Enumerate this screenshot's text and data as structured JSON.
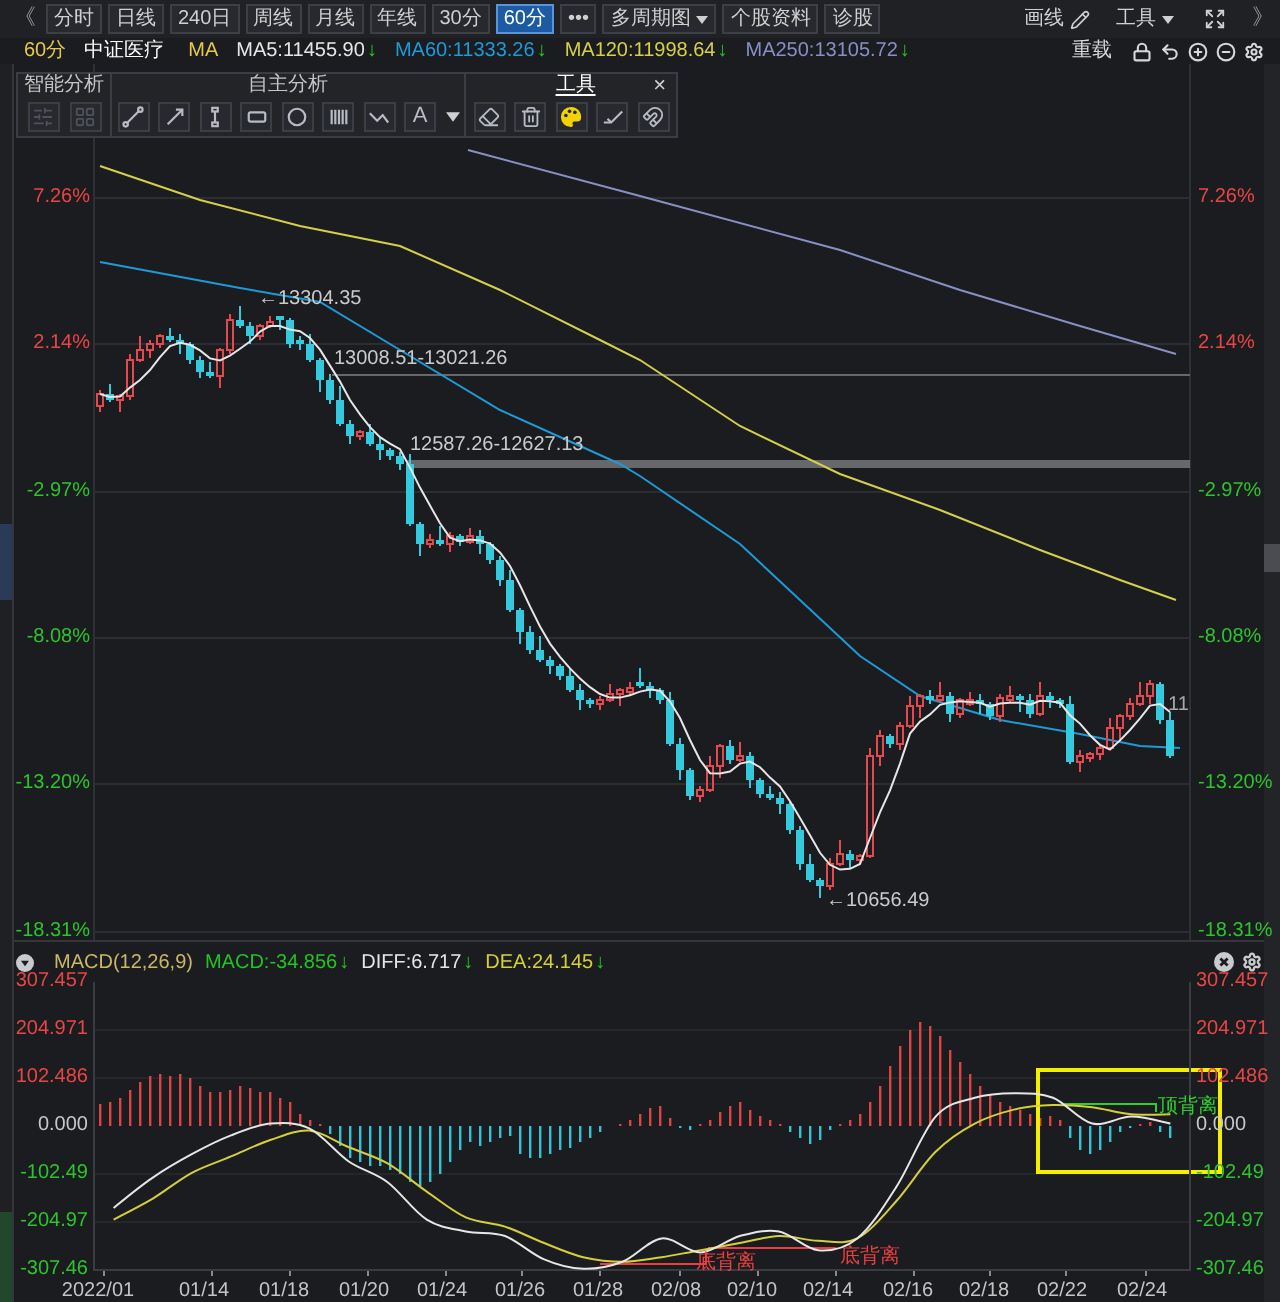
{
  "toolbar": {
    "collapse": "《",
    "periods": [
      {
        "label": "分时",
        "selected": false
      },
      {
        "label": "日线",
        "selected": false
      },
      {
        "label": "240日",
        "selected": false
      },
      {
        "label": "周线",
        "selected": false
      },
      {
        "label": "月线",
        "selected": false
      },
      {
        "label": "年线",
        "selected": false
      },
      {
        "label": "30分",
        "selected": false
      },
      {
        "label": "60分",
        "selected": true
      }
    ],
    "more": "•••",
    "multi_period": "多周期图",
    "links": [
      "个股资料",
      "诊股"
    ],
    "draw": "画线",
    "tools": "工具",
    "side_toggle": "》"
  },
  "info_bar": {
    "period": "60分",
    "name": "中证医疗",
    "ma_label": "MA",
    "averages": [
      {
        "text": "MA5:11455.90",
        "color": "#e6e6e6",
        "arrow": "↓"
      },
      {
        "text": "MA60:11333.26",
        "color": "#1e9ad6",
        "arrow": "↓"
      },
      {
        "text": "MA120:11998.64",
        "color": "#d6cf4a",
        "arrow": "↓"
      },
      {
        "text": "MA250:13105.72",
        "color": "#8790c4",
        "arrow": "↓"
      }
    ],
    "reload": "重载"
  },
  "drawing_toolbar": {
    "sections": [
      {
        "title": "智能分析",
        "selected": false
      },
      {
        "title": "自主分析",
        "selected": false
      },
      {
        "title": "工具",
        "selected": true
      }
    ],
    "close": "×",
    "smart_tools": [
      {
        "disabled": true
      },
      {
        "disabled": true
      }
    ],
    "text_tool": "A"
  },
  "price_chart": {
    "left_axis": [
      {
        "label": "7.26%",
        "color": "#e84545"
      },
      {
        "label": "2.14%",
        "color": "#e84545"
      },
      {
        "label": "-2.97%",
        "color": "#2cc42c"
      },
      {
        "label": "-8.08%",
        "color": "#2cc42c"
      },
      {
        "label": "-13.20%",
        "color": "#2cc42c"
      },
      {
        "label": "-18.31%",
        "color": "#2cc42c"
      }
    ],
    "right_axis": [
      {
        "label": "7.26%",
        "color": "#e84545"
      },
      {
        "label": "2.14%",
        "color": "#e84545"
      },
      {
        "label": "-2.97%",
        "color": "#2cc42c"
      },
      {
        "label": "-8.08%",
        "color": "#2cc42c"
      },
      {
        "label": "-13.20%",
        "color": "#2cc42c"
      },
      {
        "label": "-18.31%",
        "color": "#2cc42c"
      }
    ],
    "annotations": [
      {
        "kind": "high",
        "text": "←13304.35"
      },
      {
        "kind": "range",
        "text": "13008.51-13021.26"
      },
      {
        "kind": "band",
        "text": "12587.26-12627.13"
      },
      {
        "kind": "low",
        "text": "←10656.49"
      },
      {
        "kind": "last",
        "text": "11"
      }
    ]
  },
  "macd_panel": {
    "title": "MACD(12,26,9)",
    "values": [
      {
        "text": "MACD:-34.856",
        "color": "#22c322",
        "arrow": "↓"
      },
      {
        "text": "DIFF:6.717",
        "color": "#e6e6e6",
        "arrow": "↓"
      },
      {
        "text": "DEA:24.145",
        "color": "#d6cf3a",
        "arrow": "↓"
      }
    ],
    "right_axis": [
      {
        "label": "307.457",
        "color": "#e84545"
      },
      {
        "label": "204.971",
        "color": "#e84545"
      },
      {
        "label": "102.486",
        "color": "#e84545"
      },
      {
        "label": "0.000",
        "color": "#c8c8c8"
      },
      {
        "label": "-102.49",
        "color": "#2cc42c"
      },
      {
        "label": "-204.97",
        "color": "#2cc42c"
      },
      {
        "label": "-307.46",
        "color": "#2cc42c"
      }
    ],
    "signals": [
      {
        "kind": "bottom",
        "text": "底背离"
      },
      {
        "kind": "bottom",
        "text": "底背离"
      },
      {
        "kind": "top",
        "text": "顶背离"
      }
    ],
    "chart_data": {
      "type": "line",
      "categories": [
        null,
        null,
        null,
        null,
        null,
        null,
        null,
        null,
        null,
        null,
        null,
        null,
        null,
        null,
        null,
        null,
        null,
        null,
        null,
        null,
        null,
        null,
        null,
        null,
        null,
        null,
        null,
        null
      ],
      "series": [
        {
          "color": "#e6e6e6",
          "values": [
            -175,
            -110,
            -60,
            -20,
            5,
            -5,
            -75,
            -120,
            -200,
            -225,
            -235,
            -285,
            -305,
            -290,
            -240,
            -270,
            -235,
            -225,
            -265,
            -240,
            -130,
            20,
            60,
            70,
            60,
            5,
            20,
            5
          ]
        },
        {
          "color": "#d6cf3a",
          "values": [
            -200,
            -155,
            -100,
            -65,
            -30,
            -10,
            -45,
            -80,
            -140,
            -195,
            -215,
            -250,
            -280,
            -290,
            -280,
            -265,
            -250,
            -235,
            -245,
            -240,
            -160,
            -55,
            5,
            35,
            45,
            40,
            25,
            25
          ]
        }
      ],
      "yticks": [
        {
          "value": 307.457,
          "label": "307.457"
        },
        {
          "value": 204.971,
          "label": "204.971"
        },
        {
          "value": 102.486,
          "label": "102.486"
        },
        {
          "value": 0,
          "label": "0.000"
        },
        {
          "value": -102.49,
          "label": "-102.49"
        },
        {
          "value": -204.97,
          "label": "-204.97"
        },
        {
          "value": -307.46,
          "label": "-307.46"
        }
      ],
      "ylim": [
        -307.46,
        307.457
      ]
    }
  },
  "x_axis": [
    "2022/01",
    "01/14",
    "01/18",
    "01/20",
    "01/24",
    "01/26",
    "01/28",
    "02/08",
    "02/10",
    "02/14",
    "02/16",
    "02/18",
    "02/22",
    "02/24"
  ]
}
